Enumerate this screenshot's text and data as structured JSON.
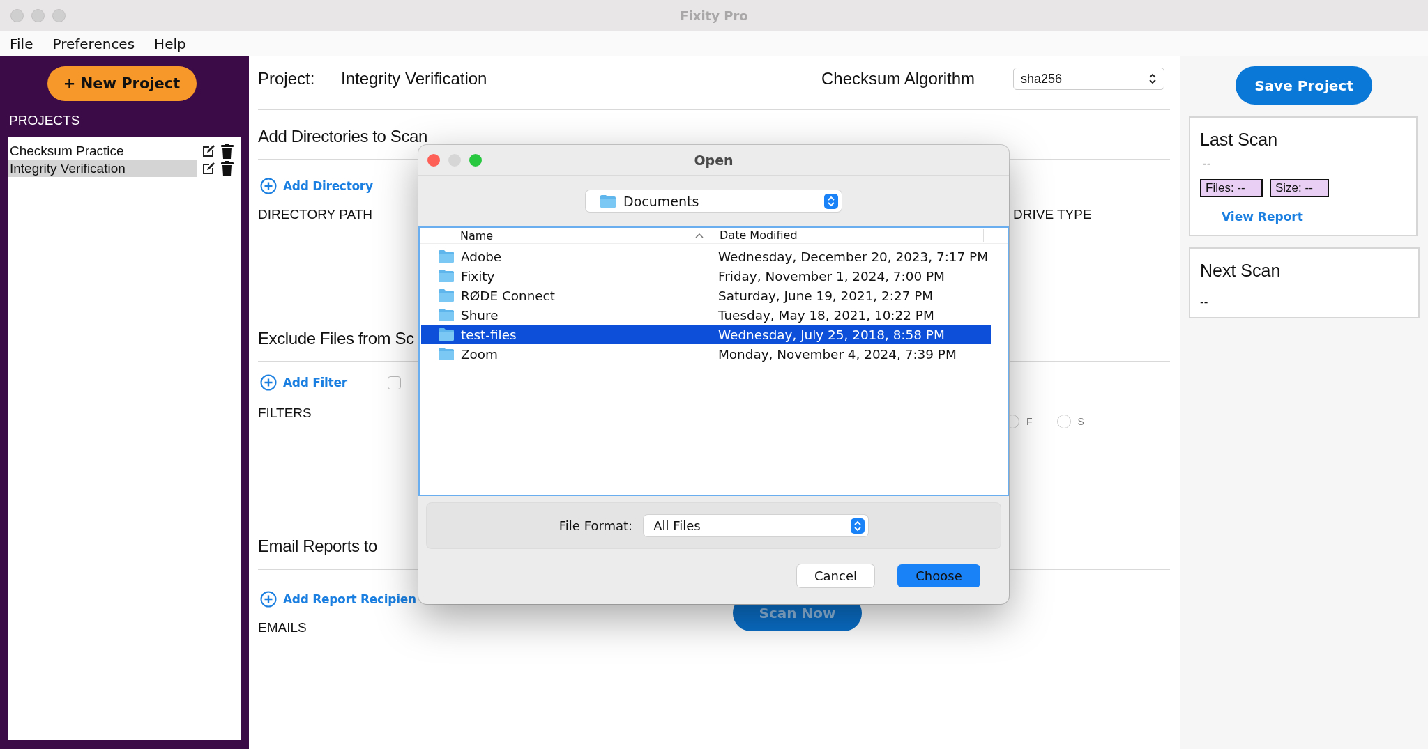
{
  "window": {
    "title": "Fixity Pro"
  },
  "menu": [
    "File",
    "Preferences",
    "Help"
  ],
  "sidebar": {
    "new_project_button": "+ New Project",
    "heading": "PROJECTS",
    "projects": [
      {
        "name": "Checksum Practice",
        "selected": false
      },
      {
        "name": "Integrity Verification",
        "selected": true
      }
    ]
  },
  "project": {
    "label": "Project:",
    "name": "Integrity Verification",
    "algorithm_label": "Checksum Algorithm",
    "algorithm": "sha256"
  },
  "directories": {
    "heading": "Add Directories to Scan",
    "add_link": "Add Directory",
    "columns": [
      "DIRECTORY PATH",
      "DRIVE TYPE"
    ]
  },
  "exclude": {
    "heading": "Exclude Files from Sc",
    "add_link": "Add Filter",
    "checkbox": {
      "checked": false
    },
    "list_label": "FILTERS",
    "radios": [
      {
        "label": "F",
        "selected": false
      },
      {
        "label": "S",
        "selected": false
      }
    ]
  },
  "email": {
    "heading": "Email Reports to",
    "add_link": "Add Report Recipien",
    "list_label": "EMAILS",
    "scan_button": "Scan Now"
  },
  "save_button": "Save Project",
  "last_scan": {
    "title": "Last Scan",
    "value": "--",
    "files": "Files: --",
    "size": "Size: --",
    "link": "View Report"
  },
  "next_scan": {
    "title": "Next Scan",
    "value": "--"
  },
  "dialog": {
    "title": "Open",
    "location": "Documents",
    "columns": [
      "Name",
      "Date Modified"
    ],
    "files": [
      {
        "name": "Adobe",
        "date": "Wednesday, December 20, 2023, 7:17 PM",
        "selected": false
      },
      {
        "name": "Fixity",
        "date": "Friday, November 1, 2024, 7:00 PM",
        "selected": false
      },
      {
        "name": "RØDE Connect",
        "date": "Saturday, June 19, 2021, 2:27 PM",
        "selected": false
      },
      {
        "name": "Shure",
        "date": "Tuesday, May 18, 2021, 10:22 PM",
        "selected": false
      },
      {
        "name": "test-files",
        "date": "Wednesday, July 25, 2018, 8:58 PM",
        "selected": true
      },
      {
        "name": "Zoom",
        "date": "Monday, November 4, 2024, 7:39 PM",
        "selected": false
      }
    ],
    "format_label": "File Format:",
    "format": "All Files",
    "buttons": [
      {
        "label": "Cancel",
        "kind": "secondary"
      },
      {
        "label": "Choose",
        "kind": "primary"
      }
    ]
  }
}
